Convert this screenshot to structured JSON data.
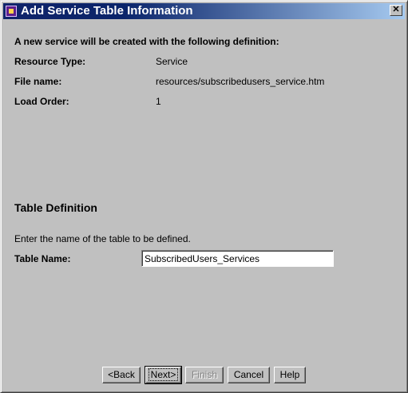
{
  "window": {
    "title": "Add Service Table Information",
    "close_label": "✕"
  },
  "intro": "A new service will be created with the following definition:",
  "definition": {
    "resource_type_label": "Resource Type:",
    "resource_type_value": "Service",
    "file_name_label": "File name:",
    "file_name_value": "resources/subscribedusers_service.htm",
    "load_order_label": "Load Order:",
    "load_order_value": "1"
  },
  "table_definition": {
    "heading": "Table Definition",
    "instruction": "Enter the name of the table to be defined.",
    "table_name_label": "Table Name:",
    "table_name_value": "SubscribedUsers_Services"
  },
  "buttons": {
    "back": "<Back",
    "next": "Next>",
    "finish": "Finish",
    "cancel": "Cancel",
    "help": "Help"
  }
}
